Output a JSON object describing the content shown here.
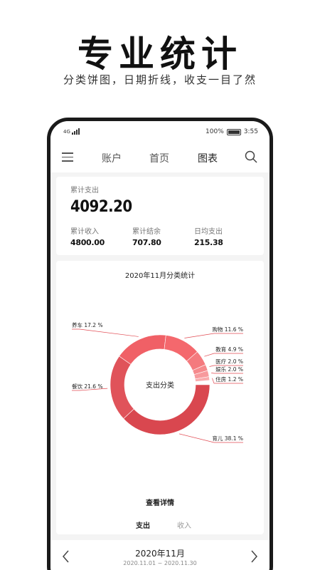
{
  "promo": {
    "title": "专业统计",
    "subtitle": "分类饼图，日期折线，收支一目了然"
  },
  "statusbar": {
    "carrier": "4G",
    "battery": "100%",
    "time": "3:55"
  },
  "nav": {
    "tabs": [
      {
        "label": "账户",
        "active": false
      },
      {
        "label": "首页",
        "active": false
      },
      {
        "label": "图表",
        "active": true
      }
    ]
  },
  "summary": {
    "total_expense_label": "累计支出",
    "total_expense_value": "4092.20",
    "stats": [
      {
        "label": "累计收入",
        "value": "4800.00"
      },
      {
        "label": "累计结余",
        "value": "707.80"
      },
      {
        "label": "日均支出",
        "value": "215.38"
      }
    ]
  },
  "chart_section": {
    "detail_link": "查看详情",
    "toggle_expense": "支出",
    "toggle_income": "收入"
  },
  "chart_data": {
    "type": "pie",
    "title": "2020年11月分类统计",
    "center_label": "支出分类",
    "slices": [
      {
        "name": "育儿",
        "percent": 38.1,
        "label": "育儿 38.1 %",
        "color": "#d9474f"
      },
      {
        "name": "餐饮",
        "percent": 21.6,
        "label": "餐饮 21.6 %",
        "color": "#e0535a"
      },
      {
        "name": "养车",
        "percent": 17.2,
        "label": "养车 17.2 %",
        "color": "#f06066"
      },
      {
        "name": "购物",
        "percent": 11.6,
        "label": "购物 11.6 %",
        "color": "#f4686d"
      },
      {
        "name": "教育",
        "percent": 4.9,
        "label": "教育 4.9 %",
        "color": "#f47a7e"
      },
      {
        "name": "医疗",
        "percent": 2.0,
        "label": "医疗 2.0 %",
        "color": "#f58a8d"
      },
      {
        "name": "娱乐",
        "percent": 2.0,
        "label": "娱乐 2.0 %",
        "color": "#f79a9d"
      },
      {
        "name": "住房",
        "percent": 1.2,
        "label": "住房 1.2 %",
        "color": "#f9acae"
      }
    ],
    "accent": "#e14b53"
  },
  "month_bar": {
    "month": "2020年11月",
    "range": "2020.11.01 ~ 2020.11.30"
  }
}
